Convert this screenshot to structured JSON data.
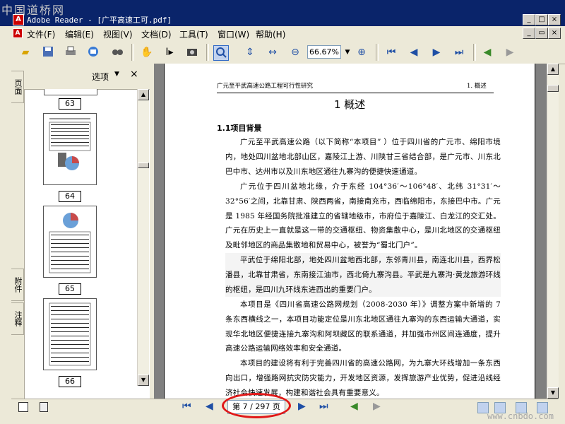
{
  "watermark": "中国道桥网",
  "window": {
    "title": "Adobe Reader - [广平高速工可.pdf]",
    "min": "_",
    "max": "□",
    "close": "×",
    "restore": "▭"
  },
  "menu": [
    {
      "label": "文件(F)"
    },
    {
      "label": "编辑(E)"
    },
    {
      "label": "视图(V)"
    },
    {
      "label": "文档(D)"
    },
    {
      "label": "工具(T)"
    },
    {
      "label": "窗口(W)"
    },
    {
      "label": "帮助(H)"
    }
  ],
  "toolbar": {
    "icons": [
      "open-icon",
      "save-icon",
      "print-icon",
      "email-icon",
      "search-icon",
      "hand-icon",
      "select-text-icon",
      "snapshot-icon",
      "zoom-in-tool-icon",
      "fit-height-icon",
      "fit-width-icon",
      "zoom-out-icon",
      "zoom-in-icon",
      "first-page-icon",
      "prev-page-icon",
      "next-page-icon",
      "last-page-icon",
      "back-icon",
      "forward-icon"
    ],
    "zoom": "66.67%"
  },
  "nav_tabs": [
    "页面",
    "附件",
    "注释"
  ],
  "thumbnails": {
    "options_label": "选项",
    "close": "×",
    "pages": [
      "63",
      "64",
      "65",
      "66"
    ]
  },
  "document": {
    "header_left": "广元至平武高速公路工程可行性研究",
    "header_right": "1. 概述",
    "chapter_title": "1 概述",
    "section_title": "1.1项目背景",
    "paragraphs": [
      "广元至平武高速公路（以下简称“本项目” ）位于四川省的广元市、绵阳市境内，地处四川盆地北部山区，嘉陵江上游、川陕甘三省结合部，是广元市、川东北巴中市、达州市以及川东地区通往九寨沟的便捷快速通道。",
      "广元位于四川盆地北缘，介于东经 104°36′～106°48′、北纬 31°31′～32°56′之间，北靠甘肃、陕西两省，南接南充市，西临绵阳市，东接巴中市。广元是 1985 年经国务院批准建立的省辖地级市，市府位于嘉陵江、白龙江的交汇处。广元在历史上一直就是这一带的交通枢纽、物资集散中心，是川北地区的交通枢纽及毗邻地区的商品集散地和贸易中心，被誉为“蜀北门户”。",
      "平武位于绵阳北部，地处四川盆地西北部，东邻青川县，南连北川县，西界松潘县，北靠甘肃省，东南接江油市，西北倚九寨沟县。平武是九寨沟·黄龙旅游环线的枢纽，是四川九环线东进西出的重要门户。",
      "本项目是《四川省高速公路网规划（2008-2030 年）》调整方案中新增的 7 条东西横线之一，本项目功能定位是川东北地区通往九寨沟的东西运输大通道，实现华北地区便捷连接九寨沟和阿坝藏区的联系通道，并加强市州区间连通度，提升高速公路运输网络效率和安全通道。",
      "本项目的建设将有利于完善四川省的高速公路网，为九寨大环线增加一条东西向出口，增强路网抗灾防灾能力，开发地区资源，发挥旅游产业优势，促进沿线经济社会快速发展，构建和谐社会具有重要意义。"
    ]
  },
  "status": {
    "page_indicator": "第 7 / 297 页",
    "footer_watermark": "www.cnbdo.com"
  },
  "colors": {
    "title_bar": "#0a246a",
    "highlight": "#e01818",
    "doc_bg": "#808080"
  }
}
